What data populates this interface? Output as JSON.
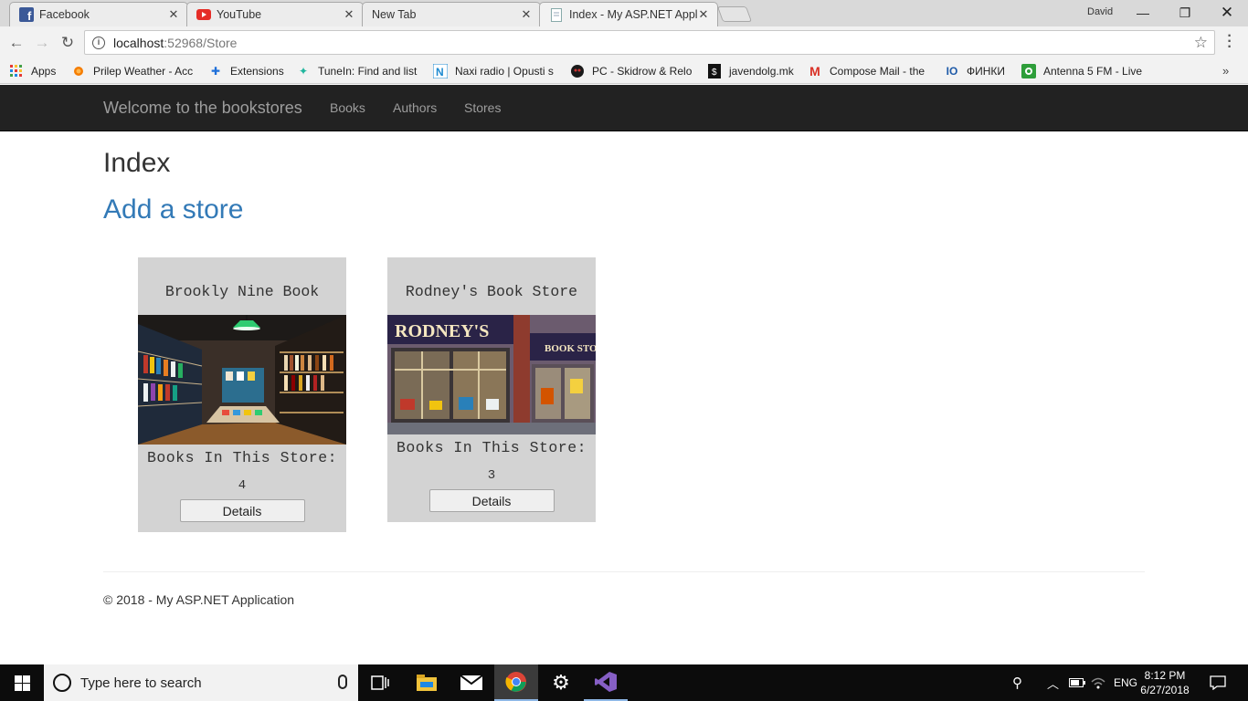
{
  "browser": {
    "tabs": [
      {
        "title": "Facebook",
        "icon": "facebook-icon"
      },
      {
        "title": "YouTube",
        "icon": "youtube-icon"
      },
      {
        "title": "New Tab",
        "icon": ""
      },
      {
        "title": "Index - My ASP.NET Appl",
        "icon": "page-icon",
        "active": true
      }
    ],
    "profile": "David",
    "url_host": "localhost",
    "url_path": ":52968/Store",
    "bookmarks": [
      {
        "label": "Apps",
        "icon": "apps-grid-icon"
      },
      {
        "label": "Prilep Weather - Acc",
        "icon": "weather-icon"
      },
      {
        "label": "Extensions",
        "icon": "puzzle-icon"
      },
      {
        "label": "TuneIn: Find and list",
        "icon": "tunein-icon"
      },
      {
        "label": "Naxi radio | Opusti s",
        "icon": "naxi-icon"
      },
      {
        "label": "PC - Skidrow & Relo",
        "icon": "skidrow-icon"
      },
      {
        "label": "javendolg.mk",
        "icon": "javendolg-icon"
      },
      {
        "label": "Compose Mail - the",
        "icon": "gmail-icon"
      },
      {
        "label": "ФИНКИ",
        "icon": "finki-icon"
      },
      {
        "label": "Antenna 5 FM - Live",
        "icon": "antenna5-icon"
      }
    ]
  },
  "site": {
    "brand": "Welcome to the bookstores",
    "nav": [
      "Books",
      "Authors",
      "Stores"
    ],
    "page_title": "Index",
    "add_link": "Add a store",
    "stores": [
      {
        "name": "Brookly Nine Book",
        "count_label": "Books In This Store:",
        "count": "4",
        "details": "Details"
      },
      {
        "name": "Rodney's Book Store",
        "count_label": "Books In This Store:",
        "count": "3",
        "details": "Details"
      }
    ],
    "footer": "© 2018 - My ASP.NET Application"
  },
  "taskbar": {
    "search_placeholder": "Type here to search",
    "language": "ENG",
    "time": "8:12 PM",
    "date": "6/27/2018"
  },
  "colors": {
    "navbar_bg": "#222222",
    "link_blue": "#337ab7",
    "card_bg": "#d3d3d3"
  }
}
